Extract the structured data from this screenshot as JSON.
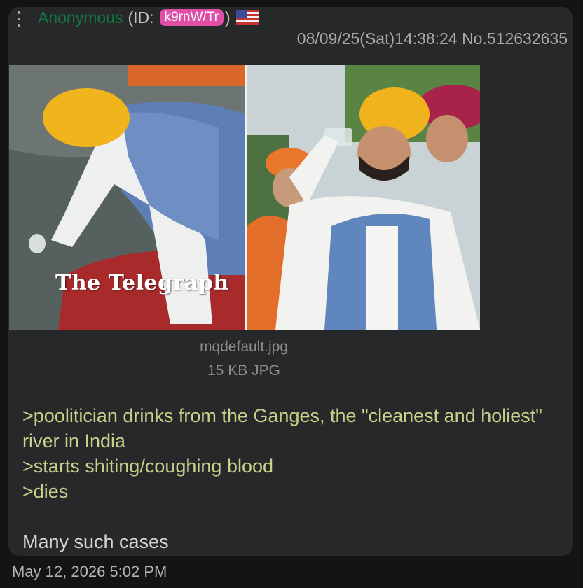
{
  "post": {
    "name": "Anonymous",
    "id_prefix": "(ID:",
    "poster_id": "k9rnW/Tr",
    "id_suffix": ")",
    "flag_icon": "us-flag-icon",
    "timestamp": "08/09/25(Sat)14:38:24 No.512632635"
  },
  "image": {
    "watermark": "The Telegraph",
    "filename": "mqdefault.jpg",
    "fileinfo": "15 KB JPG"
  },
  "body": {
    "lines": [
      ">poolitician drinks from the Ganges, the \"cleanest and holiest\" river in India",
      ">starts shiting/coughing blood",
      ">dies"
    ],
    "closing": "Many such cases"
  },
  "footer": {
    "date": "May 12, 2026 5:02 PM"
  },
  "colors": {
    "card_bg": "#27282a",
    "name": "#117743",
    "id_badge": "#e04ea7",
    "greentext": "#c5d28a"
  }
}
